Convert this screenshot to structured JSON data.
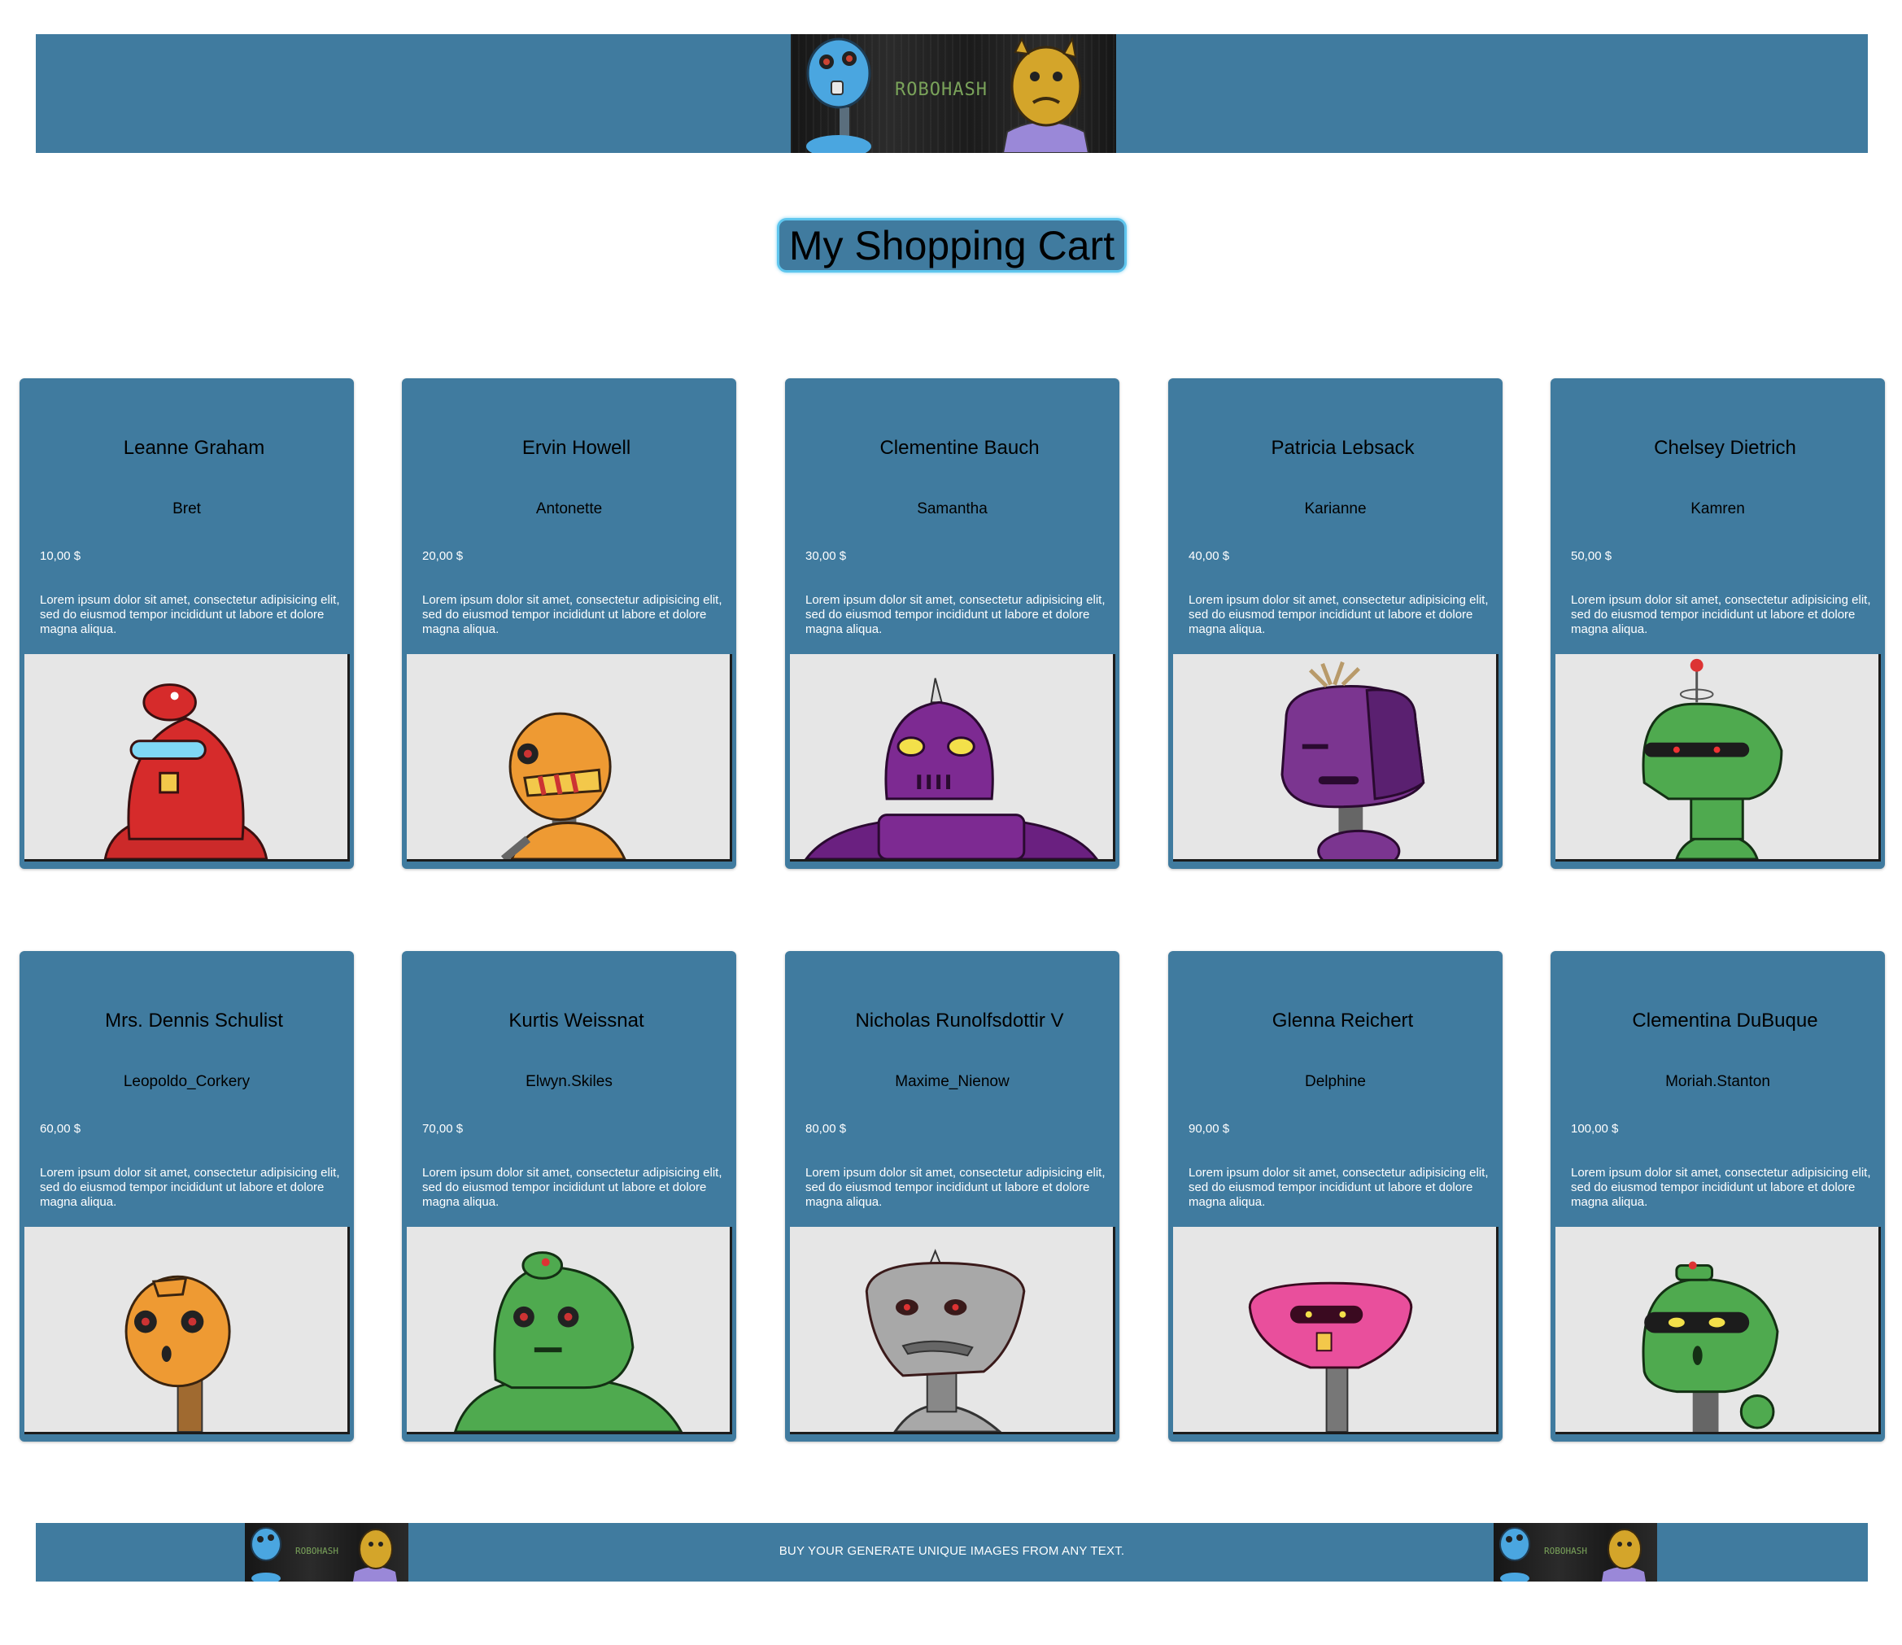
{
  "header": {
    "banner_text": "ROBOHASH"
  },
  "page_title": "My Shopping Cart",
  "colors": {
    "bar": "#407b9f",
    "title_border": "#5fc6ee",
    "image_bg": "#e6e6e6"
  },
  "products": [
    {
      "name": "Leanne Graham",
      "username": "Bret",
      "price": "10,00 $",
      "description": "Lorem ipsum dolor sit amet, consectetur adipisicing elit, sed do eiusmod tempor incididunt ut labore et dolore magna aliqua.",
      "robot_color": "#d62b2b",
      "robot_icon": "red-robot-icon"
    },
    {
      "name": "Ervin Howell",
      "username": "Antonette",
      "price": "20,00 $",
      "description": "Lorem ipsum dolor sit amet, consectetur adipisicing elit, sed do eiusmod tempor incididunt ut labore et dolore magna aliqua.",
      "robot_color": "#ee9a33",
      "robot_icon": "orange-robot-icon"
    },
    {
      "name": "Clementine Bauch",
      "username": "Samantha",
      "price": "30,00 $",
      "description": "Lorem ipsum dolor sit amet, consectetur adipisicing elit, sed do eiusmod tempor incididunt ut labore et dolore magna aliqua.",
      "robot_color": "#7d2a92",
      "robot_icon": "purple-robot-icon"
    },
    {
      "name": "Patricia Lebsack",
      "username": "Karianne",
      "price": "40,00 $",
      "description": "Lorem ipsum dolor sit amet, consectetur adipisicing elit, sed do eiusmod tempor incididunt ut labore et dolore magna aliqua.",
      "robot_color": "#7b3590",
      "robot_icon": "purple-robot-icon"
    },
    {
      "name": "Chelsey Dietrich",
      "username": "Kamren",
      "price": "50,00 $",
      "description": "Lorem ipsum dolor sit amet, consectetur adipisicing elit, sed do eiusmod tempor incididunt ut labore et dolore magna aliqua.",
      "robot_color": "#4faa4f",
      "robot_icon": "green-robot-icon"
    },
    {
      "name": "Mrs. Dennis Schulist",
      "username": "Leopoldo_Corkery",
      "price": "60,00 $",
      "description": "Lorem ipsum dolor sit amet, consectetur adipisicing elit, sed do eiusmod tempor incididunt ut labore et dolore magna aliqua.",
      "robot_color": "#ee9a33",
      "robot_icon": "orange-robot-icon"
    },
    {
      "name": "Kurtis Weissnat",
      "username": "Elwyn.Skiles",
      "price": "70,00 $",
      "description": "Lorem ipsum dolor sit amet, consectetur adipisicing elit, sed do eiusmod tempor incididunt ut labore et dolore magna aliqua.",
      "robot_color": "#4faa4f",
      "robot_icon": "green-robot-icon"
    },
    {
      "name": "Nicholas Runolfsdottir V",
      "username": "Maxime_Nienow",
      "price": "80,00 $",
      "description": "Lorem ipsum dolor sit amet, consectetur adipisicing elit, sed do eiusmod tempor incididunt ut labore et dolore magna aliqua.",
      "robot_color": "#a8a8a8",
      "robot_icon": "gray-robot-icon"
    },
    {
      "name": "Glenna Reichert",
      "username": "Delphine",
      "price": "90,00 $",
      "description": "Lorem ipsum dolor sit amet, consectetur adipisicing elit, sed do eiusmod tempor incididunt ut labore et dolore magna aliqua.",
      "robot_color": "#e94f9c",
      "robot_icon": "pink-robot-icon"
    },
    {
      "name": "Clementina DuBuque",
      "username": "Moriah.Stanton",
      "price": "100,00 $",
      "description": "Lorem ipsum dolor sit amet, consectetur adipisicing elit, sed do eiusmod tempor incididunt ut labore et dolore magna aliqua.",
      "robot_color": "#4faa4f",
      "robot_icon": "green-robot-icon"
    }
  ],
  "footer": {
    "text": "BUY YOUR GENERATE UNIQUE IMAGES FROM ANY TEXT.",
    "logo_text": "ROBOHASH"
  }
}
